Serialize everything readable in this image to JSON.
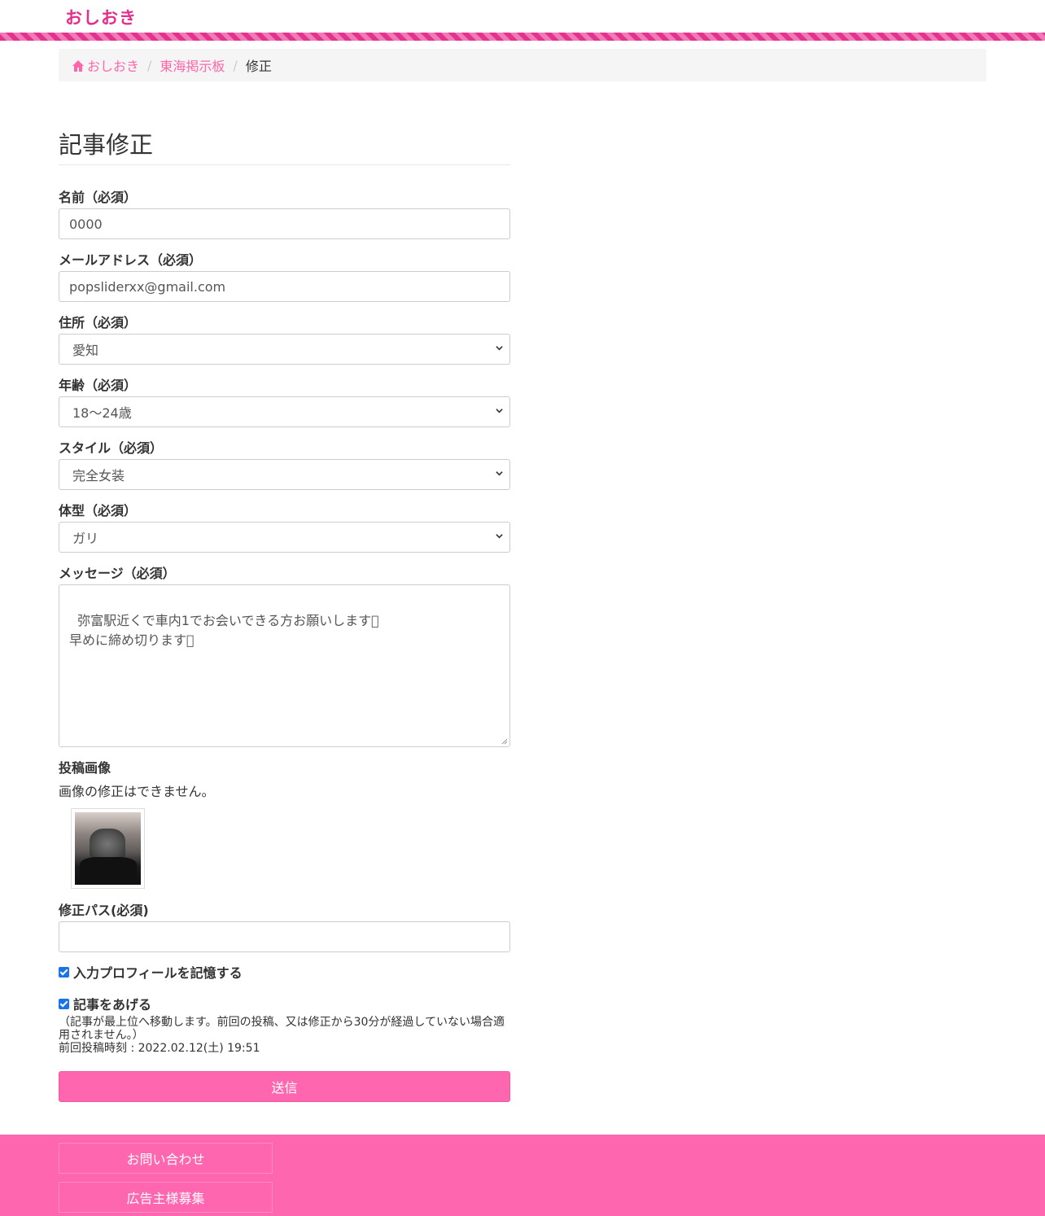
{
  "header": {
    "logo": "おしおき"
  },
  "breadcrumb": {
    "home": "おしおき",
    "board": "東海掲示板",
    "current": "修正",
    "separator": "/"
  },
  "form": {
    "title": "記事修正",
    "name": {
      "label": "名前（必須）",
      "value": "0000"
    },
    "email": {
      "label": "メールアドレス（必須）",
      "value": "popsliderxx@gmail.com"
    },
    "address": {
      "label": "住所（必須）",
      "value": "愛知"
    },
    "age": {
      "label": "年齢（必須）",
      "value": "18〜24歳"
    },
    "style": {
      "label": "スタイル（必須）",
      "value": "完全女装"
    },
    "body_type": {
      "label": "体型（必須）",
      "value": "ガリ"
    },
    "message": {
      "label": "メッセージ（必須）",
      "value": "弥富駅近くで車内1でお会いできる方お願いします\u0000\n早めに締め切ります\u0000"
    },
    "image": {
      "label": "投稿画像",
      "note": "画像の修正はできません。"
    },
    "password": {
      "label": "修正パス(必須)",
      "value": ""
    },
    "remember": {
      "label": "入力プロフィールを記憶する",
      "checked": true
    },
    "bump": {
      "label": "記事をあげる",
      "checked": true
    },
    "bump_note": "（記事が最上位へ移動します。前回の投稿、又は修正から30分が経過していない場合適用されません。）",
    "last_post": "前回投稿時刻 : 2022.02.12(土) 19:51",
    "submit_label": "送信"
  },
  "footer": {
    "contact": "お問い合わせ",
    "advertisers": "広告主様募集"
  },
  "colors": {
    "accent": "#ff66b0",
    "link": "#ff66aa",
    "logo": "#e62e8b"
  }
}
